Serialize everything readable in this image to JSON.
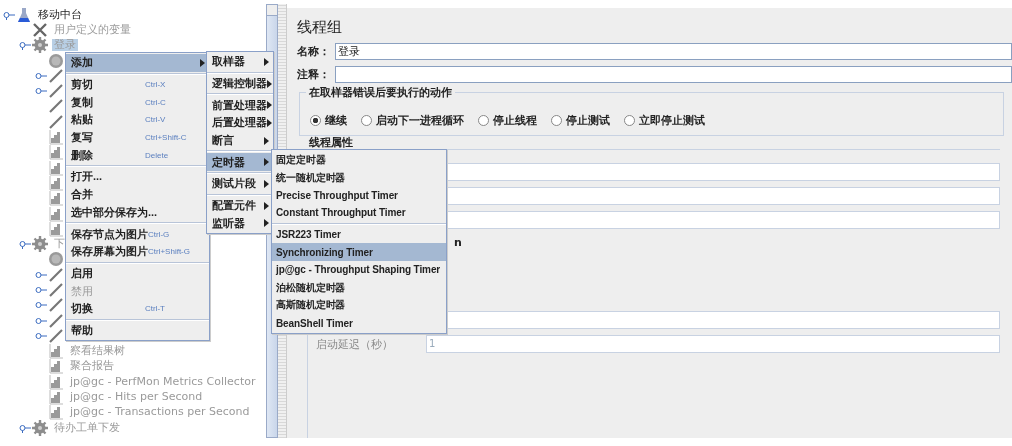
{
  "tree": {
    "root": {
      "label": "移动中台",
      "kind": "plan",
      "expanded": true,
      "disabled": false,
      "selected": false,
      "children": [
        {
          "label": "用户定义的变量",
          "kind": "variables",
          "disabled": true,
          "selected": false
        },
        {
          "label": "登录",
          "kind": "thread-group",
          "expanded": true,
          "disabled": true,
          "selected": true,
          "children": [
            {
              "kind": "timer"
            },
            {
              "kind": "sampler",
              "expanded": false
            },
            {
              "kind": "sampler",
              "expanded": false
            },
            {
              "kind": "sampler"
            },
            {
              "kind": "sampler"
            },
            {
              "kind": "listener"
            },
            {
              "kind": "listener"
            },
            {
              "kind": "listener"
            },
            {
              "kind": "listener"
            },
            {
              "kind": "listener"
            },
            {
              "kind": "listener"
            },
            {
              "kind": "listener"
            }
          ]
        },
        {
          "label": "下",
          "kind": "thread-group",
          "expanded": true,
          "disabled": true,
          "selected": false,
          "children": [
            {
              "kind": "timer"
            },
            {
              "kind": "sampler",
              "expanded": false
            },
            {
              "kind": "sampler",
              "expanded": false
            },
            {
              "kind": "sampler",
              "expanded": false
            },
            {
              "kind": "sampler",
              "expanded": false
            },
            {
              "kind": "sampler",
              "expanded": false
            },
            {
              "label": "察看结果树",
              "kind": "listener",
              "disabled": true,
              "selected": false
            },
            {
              "label": "聚合报告",
              "kind": "listener",
              "disabled": true,
              "selected": false
            },
            {
              "label": "jp@gc - PerfMon Metrics Collector",
              "kind": "listener",
              "disabled": true,
              "selected": false
            },
            {
              "label": "jp@gc - Hits per Second",
              "kind": "listener",
              "disabled": true,
              "selected": false
            },
            {
              "label": "jp@gc - Transactions per Second",
              "kind": "listener",
              "disabled": true,
              "selected": false
            }
          ]
        },
        {
          "label": "待办工单下发",
          "kind": "thread-group",
          "expanded": true,
          "disabled": true,
          "selected": false
        }
      ]
    }
  },
  "panel": {
    "title": "线程组",
    "name_field": {
      "label": "名称：",
      "value": "登录"
    },
    "comment_field": {
      "label": "注释："
    },
    "error_action": {
      "title": "在取样器错误后要执行的动作",
      "options": [
        {
          "label": "继续",
          "selected": true
        },
        {
          "label": "启动下一进程循环",
          "selected": false
        },
        {
          "label": "停止线程",
          "selected": false
        },
        {
          "label": "停止测试",
          "selected": false
        },
        {
          "label": "立即停止测试",
          "selected": false
        }
      ]
    },
    "thread_properties": {
      "title": "线程属性",
      "rows": [
        {
          "kind": "field"
        },
        {
          "kind": "field"
        },
        {
          "kind": "field"
        },
        {
          "kind": "label",
          "label": "n"
        },
        {
          "kind": "gap"
        },
        {
          "kind": "field"
        },
        {
          "kind": "field",
          "label": "启动延迟（秒）",
          "value": "1",
          "disabled": true
        }
      ]
    }
  },
  "context_menu": {
    "groups": [
      [
        {
          "label": "添加",
          "submenu": true,
          "selected": true,
          "disabled": false
        }
      ],
      [
        {
          "label": "剪切",
          "shortcut": "Ctrl-X",
          "selected": false,
          "disabled": false
        },
        {
          "label": "复制",
          "shortcut": "Ctrl-C",
          "selected": false,
          "disabled": false
        },
        {
          "label": "粘贴",
          "shortcut": "Ctrl-V",
          "selected": false,
          "disabled": false
        },
        {
          "label": "复写",
          "shortcut": "Ctrl+Shift-C",
          "selected": false,
          "disabled": false
        },
        {
          "label": "删除",
          "shortcut": "Delete",
          "selected": false,
          "disabled": false
        }
      ],
      [
        {
          "label": "打开...",
          "selected": false,
          "disabled": false
        },
        {
          "label": "合并",
          "selected": false,
          "disabled": false
        },
        {
          "label": "选中部分保存为...",
          "selected": false,
          "disabled": false
        }
      ],
      [
        {
          "label": "保存节点为图片",
          "shortcut": "Ctrl-G",
          "selected": false,
          "disabled": false
        },
        {
          "label": "保存屏幕为图片",
          "shortcut": "Ctrl+Shift-G",
          "selected": false,
          "disabled": false
        }
      ],
      [
        {
          "label": "启用",
          "selected": false,
          "disabled": false
        },
        {
          "label": "禁用",
          "selected": false,
          "disabled": true
        },
        {
          "label": "切换",
          "shortcut": "Ctrl-T",
          "selected": false,
          "disabled": false
        }
      ],
      [
        {
          "label": "帮助",
          "selected": false,
          "disabled": false
        }
      ]
    ]
  },
  "add_menu": {
    "groups": [
      [
        {
          "label": "取样器",
          "submenu": true,
          "selected": false
        }
      ],
      [
        {
          "label": "逻辑控制器",
          "submenu": true,
          "selected": false
        }
      ],
      [
        {
          "label": "前置处理器",
          "submenu": true,
          "selected": false
        },
        {
          "label": "后置处理器",
          "submenu": true,
          "selected": false
        },
        {
          "label": "断言",
          "submenu": true,
          "selected": false
        }
      ],
      [
        {
          "label": "定时器",
          "submenu": true,
          "selected": true
        }
      ],
      [
        {
          "label": "测试片段",
          "submenu": true,
          "selected": false
        }
      ],
      [
        {
          "label": "配置元件",
          "submenu": true,
          "selected": false
        },
        {
          "label": "监听器",
          "submenu": true,
          "selected": false
        }
      ]
    ]
  },
  "timer_menu": {
    "groups": [
      [
        {
          "label": "固定定时器",
          "selected": false
        },
        {
          "label": "统一随机定时器",
          "selected": false
        },
        {
          "label": "Precise Throughput Timer",
          "selected": false
        },
        {
          "label": "Constant Throughput Timer",
          "selected": false
        }
      ],
      [
        {
          "label": "JSR223 Timer",
          "selected": false
        },
        {
          "label": "Synchronizing Timer",
          "selected": true
        },
        {
          "label": "jp@gc - Throughput Shaping Timer",
          "selected": false
        },
        {
          "label": "泊松随机定时器",
          "selected": false
        },
        {
          "label": "高斯随机定时器",
          "selected": false
        },
        {
          "label": "BeanShell Timer",
          "selected": false
        }
      ]
    ]
  }
}
